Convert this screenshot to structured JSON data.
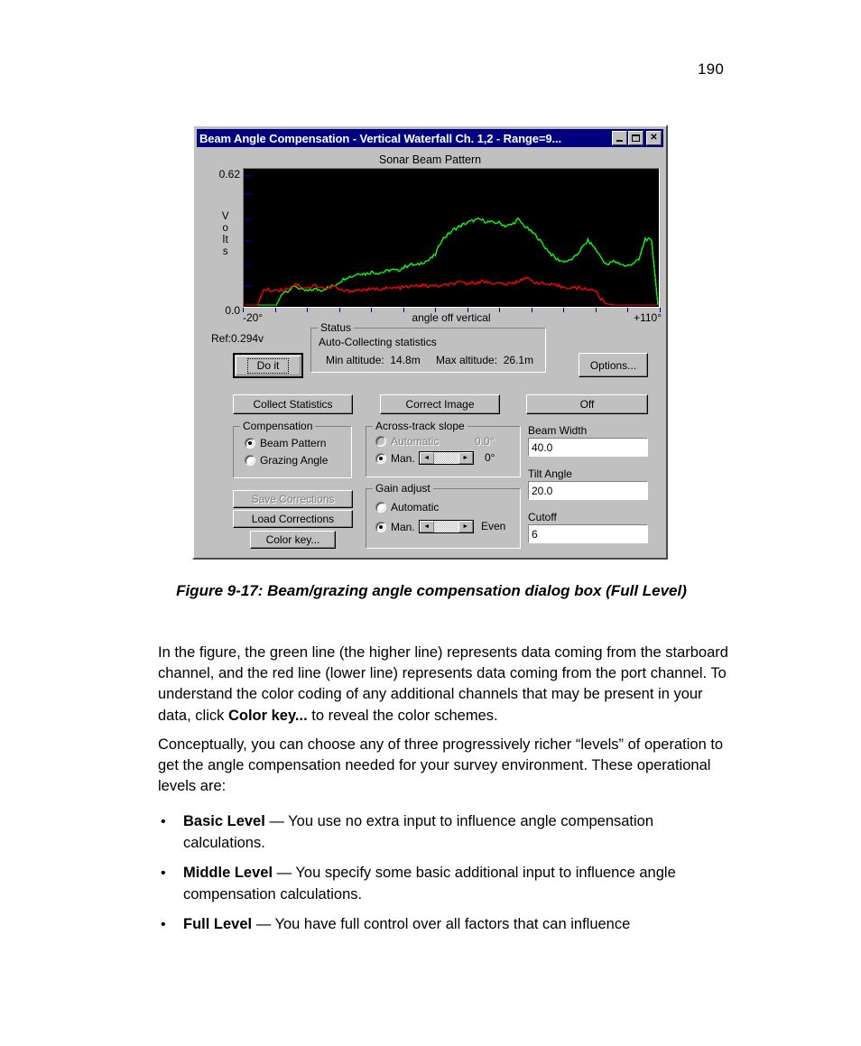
{
  "page": {
    "number": "190"
  },
  "dialog": {
    "title": "Beam Angle Compensation - Vertical Waterfall Ch. 1,2 - Range=9...",
    "titlebar_buttons": {
      "minimize": "minimize-icon",
      "maximize": "maximize-icon",
      "close": "✕"
    },
    "chart": {
      "title": "Sonar Beam Pattern",
      "y_axis_label": "Volts",
      "y_max_label": "0.62",
      "y_min_label": "0.0",
      "x_axis_label": "angle off vertical",
      "x_min_label": "-20°",
      "x_max_label": "+110°",
      "reference": "Ref:0.294v"
    },
    "status": {
      "legend": "Status",
      "line1": "Auto-Collecting statistics",
      "min_altitude_label": "Min altitude:",
      "min_altitude_value": "14.8m",
      "max_altitude_label": "Max altitude:",
      "max_altitude_value": "26.1m"
    },
    "buttons": {
      "do_it": "Do it",
      "options": "Options...",
      "collect_statistics": "Collect Statistics",
      "correct_image": "Correct Image",
      "off": "Off",
      "save_corrections": "Save Corrections",
      "load_corrections": "Load Corrections",
      "color_key": "Color key..."
    },
    "compensation": {
      "legend": "Compensation",
      "options": [
        {
          "label": "Beam Pattern",
          "selected": true
        },
        {
          "label": "Grazing Angle",
          "selected": false
        }
      ]
    },
    "across_track_slope": {
      "legend": "Across-track slope",
      "automatic_label": "Automatic",
      "automatic_value": "0.0°",
      "automatic_selected": false,
      "manual_label": "Man.",
      "manual_value": "0°",
      "manual_selected": true
    },
    "gain_adjust": {
      "legend": "Gain adjust",
      "automatic_label": "Automatic",
      "automatic_selected": false,
      "manual_label": "Man.",
      "manual_value": "Even",
      "manual_selected": true
    },
    "fields": [
      {
        "label": "Beam Width",
        "value": "40.0"
      },
      {
        "label": "Tilt Angle",
        "value": "20.0"
      },
      {
        "label": "Cutoff",
        "value": "6"
      }
    ],
    "spinner_arrows": {
      "left": "◄",
      "right": "►"
    }
  },
  "figure_caption": "Figure 9-17: Beam/grazing angle compensation dialog box (Full Level)",
  "body": {
    "paragraph1_a": "In the figure, the green line (the higher line) represents data coming from the starboard channel, and the red line (lower line) represents data coming from the port channel. To understand the color coding of any additional channels that may be present in your data, click ",
    "paragraph1_bold": "Color key...",
    "paragraph1_b": " to reveal the color schemes.",
    "paragraph2": "Conceptually, you can choose any of three progressively richer “levels” of operation to get the angle compensation needed for your survey environment. These operational levels are:",
    "bullets": [
      {
        "term": "Basic Level",
        "text": " — You use no extra input to influence angle compensation calculations."
      },
      {
        "term": "Middle Level",
        "text": " — You specify some basic additional input to influence angle compensation calculations."
      },
      {
        "term": "Full Level",
        "text": " — You have full control over all factors that can influence"
      }
    ],
    "bullet_marker": "•"
  },
  "chart_data": {
    "type": "line",
    "title": "Sonar Beam Pattern",
    "xlabel": "angle off vertical",
    "ylabel": "Volts",
    "xlim": [
      -20,
      110
    ],
    "ylim": [
      0.0,
      0.62
    ],
    "grid": false,
    "legend": "none",
    "axis_colors": {
      "background": "#000000",
      "ticks": "#000080"
    },
    "series": [
      {
        "name": "starboard channel (green)",
        "color": "#00ff00",
        "x": [
          -20,
          -18,
          -16,
          -14,
          -12,
          -10,
          -8,
          -6,
          -4,
          -2,
          0,
          2,
          4,
          6,
          8,
          10,
          12,
          14,
          16,
          18,
          20,
          22,
          24,
          26,
          28,
          30,
          32,
          34,
          36,
          38,
          40,
          42,
          44,
          46,
          48,
          50,
          52,
          54,
          56,
          58,
          60,
          62,
          64,
          66,
          68,
          70,
          72,
          74,
          76,
          78,
          80,
          82,
          84,
          86,
          88,
          90,
          92,
          94,
          96,
          98,
          100,
          102,
          104,
          106,
          108,
          110
        ],
        "y": [
          0.0,
          0.0,
          0.0,
          0.0,
          0.0,
          0.0,
          0.06,
          0.07,
          0.09,
          0.07,
          0.065,
          0.075,
          0.07,
          0.08,
          0.09,
          0.11,
          0.13,
          0.135,
          0.15,
          0.145,
          0.155,
          0.15,
          0.155,
          0.165,
          0.16,
          0.175,
          0.19,
          0.185,
          0.2,
          0.21,
          0.235,
          0.305,
          0.33,
          0.355,
          0.37,
          0.385,
          0.395,
          0.4,
          0.39,
          0.385,
          0.385,
          0.37,
          0.375,
          0.4,
          0.37,
          0.345,
          0.32,
          0.28,
          0.245,
          0.215,
          0.205,
          0.205,
          0.225,
          0.265,
          0.3,
          0.27,
          0.225,
          0.185,
          0.205,
          0.195,
          0.18,
          0.195,
          0.21,
          0.31,
          0.3,
          0.0
        ]
      },
      {
        "name": "port channel (red)",
        "color": "#ff0000",
        "x": [
          -20,
          -18,
          -16,
          -14,
          -12,
          -10,
          -8,
          -6,
          -4,
          -2,
          0,
          2,
          4,
          6,
          8,
          10,
          12,
          14,
          16,
          18,
          20,
          22,
          24,
          26,
          28,
          30,
          32,
          34,
          36,
          38,
          40,
          42,
          44,
          46,
          48,
          50,
          52,
          54,
          56,
          58,
          60,
          62,
          64,
          66,
          68,
          70,
          72,
          74,
          76,
          78,
          80,
          82,
          84,
          86,
          88,
          90,
          92,
          94,
          96,
          98,
          100,
          102,
          104,
          106,
          108,
          110
        ],
        "y": [
          0.0,
          0.0,
          0.0,
          0.07,
          0.07,
          0.07,
          0.07,
          0.08,
          0.1,
          0.085,
          0.08,
          0.09,
          0.085,
          0.075,
          0.09,
          0.07,
          0.065,
          0.068,
          0.07,
          0.072,
          0.073,
          0.075,
          0.077,
          0.078,
          0.08,
          0.082,
          0.085,
          0.09,
          0.092,
          0.088,
          0.09,
          0.088,
          0.095,
          0.1,
          0.105,
          0.1,
          0.105,
          0.11,
          0.108,
          0.105,
          0.1,
          0.098,
          0.1,
          0.11,
          0.13,
          0.115,
          0.105,
          0.1,
          0.095,
          0.09,
          0.085,
          0.082,
          0.08,
          0.078,
          0.075,
          0.07,
          0.03,
          0.005,
          0.0,
          0.0,
          0.0,
          0.0,
          0.0,
          0.0,
          0.0,
          0.0
        ]
      }
    ]
  }
}
